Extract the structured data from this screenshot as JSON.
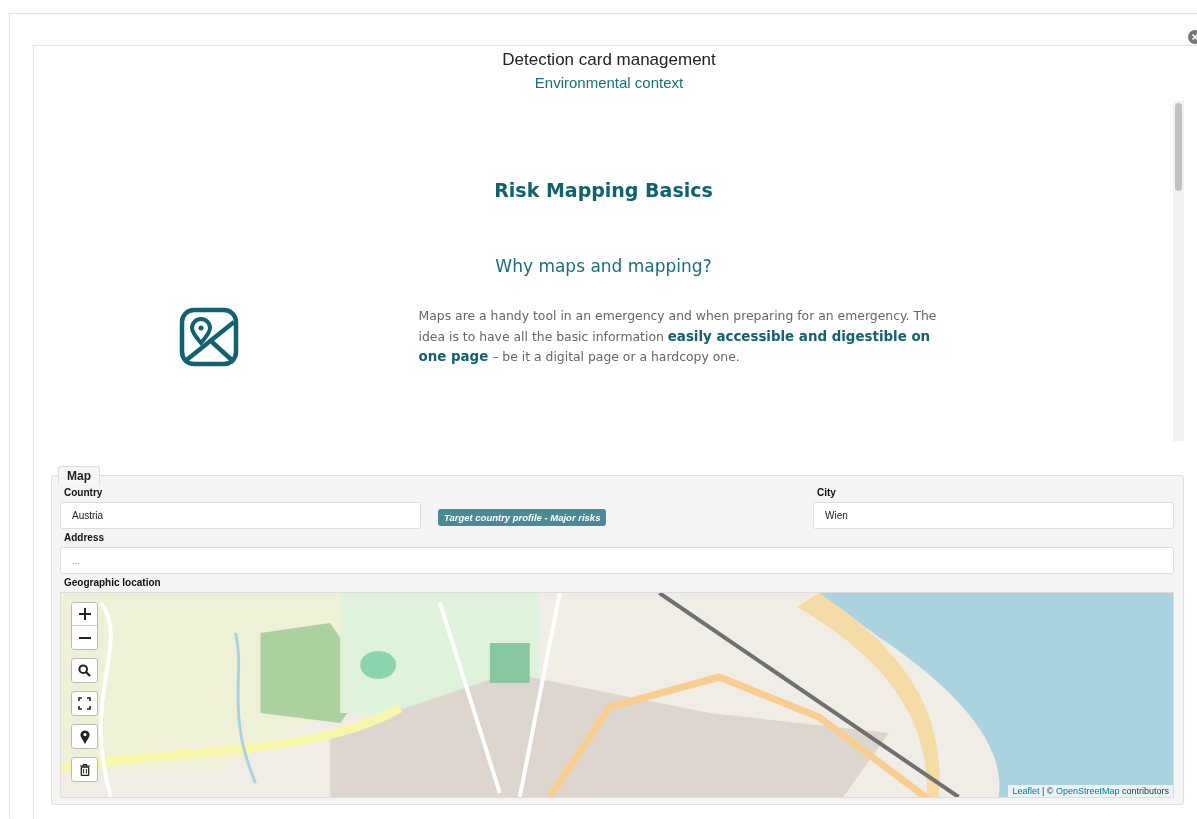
{
  "dialog": {
    "title": "Detection card management",
    "subtitle": "Environmental context"
  },
  "article": {
    "heading": "Risk Mapping Basics",
    "subheading": "Why maps and mapping?",
    "paragraph": "Maps are a handy tool in an emergency and when preparing for an emergency. The idea is to have all the basic information **easily accessible and digestible on one page** – be it a digital page or a hardcopy one."
  },
  "map_section": {
    "legend": "Map",
    "country": {
      "label": "Country",
      "value": "Austria"
    },
    "profile_link": "Target country profile - Major risks",
    "city": {
      "label": "City",
      "value": "Wien"
    },
    "address": {
      "label": "Address",
      "placeholder": "..."
    },
    "location_label": "Geographic location",
    "map": {
      "kind": "picture",
      "attribution": {
        "library": "Leaflet",
        "separator": "| ©",
        "source": "OpenStreetMap",
        "suffix": "contributors"
      }
    }
  }
}
